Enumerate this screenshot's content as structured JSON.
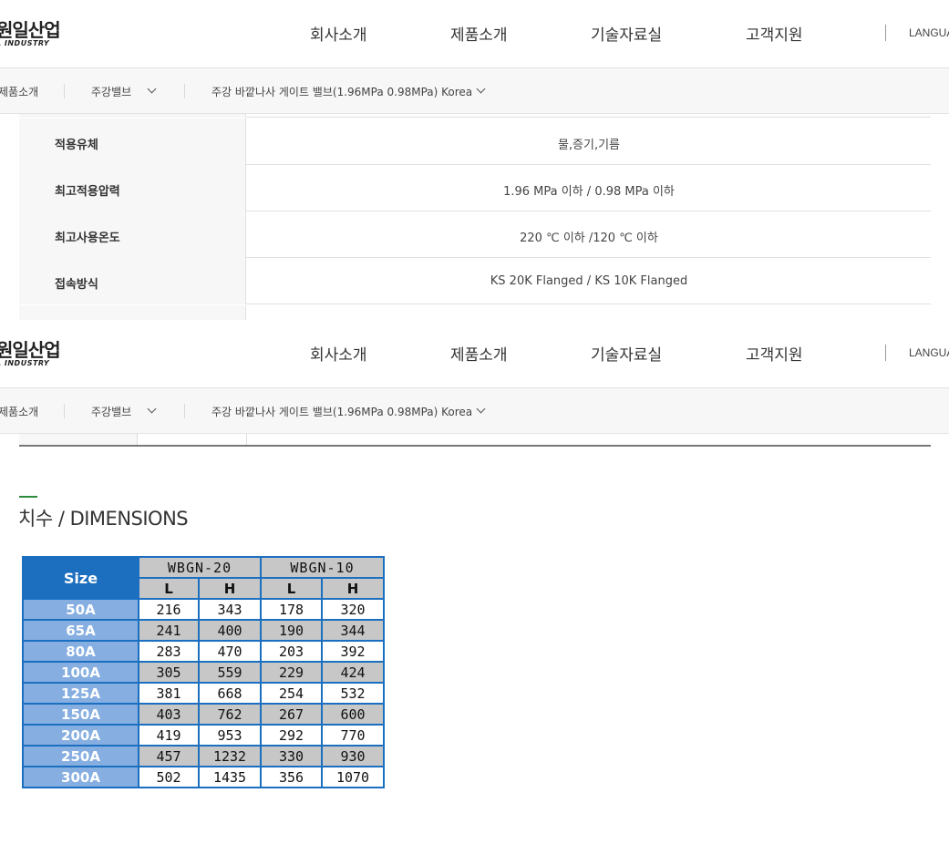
{
  "header": {
    "logo_ko": "원일산업",
    "logo_en": "L INDUSTRY",
    "nav": [
      "회사소개",
      "제품소개",
      "기술자료실",
      "고객지원"
    ],
    "language_label": "LANGUA"
  },
  "breadcrumb": {
    "items": [
      "제품소개",
      "주강밸브",
      "주강 바깥나사 게이트 밸브(1.96MPa 0.98MPa) Korea"
    ]
  },
  "spec": {
    "rows": [
      {
        "label": "적용유체",
        "value": "물,증기,기름"
      },
      {
        "label": "최고적용압력",
        "value": "1.96 MPa 이하 / 0.98 MPa 이하"
      },
      {
        "label": "최고사용온도",
        "value": "220 ℃ 이하 /120 ℃ 이하"
      },
      {
        "label": "접속방식",
        "value": "KS 20K Flanged / KS 10K Flanged"
      }
    ]
  },
  "dimensions": {
    "title": "치수 / DIMENSIONS",
    "table": {
      "size_header": "Size",
      "groups": [
        "WBGN-20",
        "WBGN-10"
      ],
      "sub_headers": [
        "L",
        "H",
        "L",
        "H"
      ],
      "rows": [
        {
          "size": "50A",
          "values": [
            "216",
            "343",
            "178",
            "320"
          ]
        },
        {
          "size": "65A",
          "values": [
            "241",
            "400",
            "190",
            "344"
          ]
        },
        {
          "size": "80A",
          "values": [
            "283",
            "470",
            "203",
            "392"
          ]
        },
        {
          "size": "100A",
          "values": [
            "305",
            "559",
            "229",
            "424"
          ]
        },
        {
          "size": "125A",
          "values": [
            "381",
            "668",
            "254",
            "532"
          ]
        },
        {
          "size": "150A",
          "values": [
            "403",
            "762",
            "267",
            "600"
          ]
        },
        {
          "size": "200A",
          "values": [
            "419",
            "953",
            "292",
            "770"
          ]
        },
        {
          "size": "250A",
          "values": [
            "457",
            "1232",
            "330",
            "930"
          ]
        },
        {
          "size": "300A",
          "values": [
            "502",
            "1435",
            "356",
            "1070"
          ]
        }
      ]
    }
  },
  "colors": {
    "accent_green": "#2e8b3e",
    "table_blue": "#1c6fbe",
    "size_cell_blue": "#86aee0",
    "grey_cell": "#c7c7c7"
  }
}
